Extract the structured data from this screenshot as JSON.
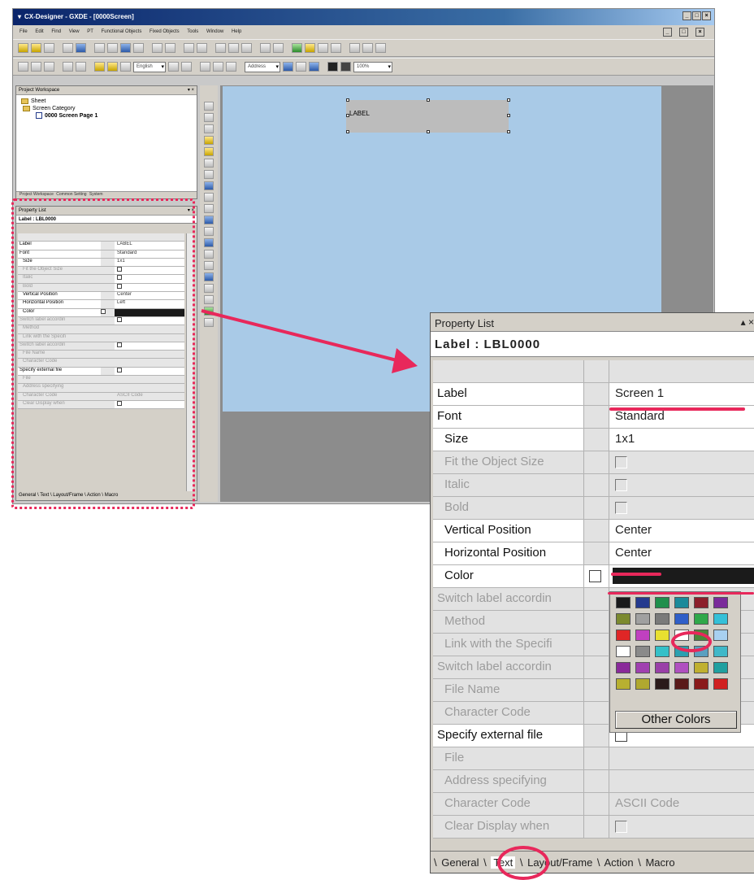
{
  "app": {
    "title": "CX-Designer - GXDE - [0000Screen]",
    "menu": [
      "File",
      "Edit",
      "Find",
      "View",
      "PT",
      "Functional Objects",
      "Fixed Objects",
      "Tools",
      "Window",
      "Help"
    ],
    "combo_language": "English",
    "combo_address": "Address",
    "combo_zoom": "100%"
  },
  "workspace": {
    "title": "Project Workspace",
    "tree": [
      "Sheet",
      "Screen Category",
      "0000 Screen Page 1"
    ],
    "tabs": [
      "Project Workspace",
      "Common Setting",
      "System"
    ]
  },
  "canvas": {
    "label_text": "LABEL"
  },
  "small_plist": {
    "title": "Property List",
    "object": "Label : LBL0000",
    "rows": [
      {
        "name": "Label",
        "value": "LABEL"
      },
      {
        "name": "Font",
        "value": "Standard"
      },
      {
        "name": "Size",
        "value": "1x1"
      },
      {
        "name": "Fit the Object Size",
        "value": ""
      },
      {
        "name": "Italic",
        "value": ""
      },
      {
        "name": "Bold",
        "value": ""
      },
      {
        "name": "Vertical Position",
        "value": "Center"
      },
      {
        "name": "Horizontal Position",
        "value": "Left"
      },
      {
        "name": "Color",
        "value": ""
      },
      {
        "name": "Switch label accordin",
        "value": ""
      },
      {
        "name": "Method",
        "value": ""
      },
      {
        "name": "Link with the Specifi",
        "value": ""
      },
      {
        "name": "Switch label accordin",
        "value": ""
      },
      {
        "name": "File Name",
        "value": ""
      },
      {
        "name": "Character Code",
        "value": ""
      },
      {
        "name": "Specify external file",
        "value": ""
      },
      {
        "name": "File",
        "value": ""
      },
      {
        "name": "Address specifying",
        "value": ""
      },
      {
        "name": "Character Code",
        "value": "ASCII Code"
      },
      {
        "name": "Clear Display when",
        "value": ""
      }
    ],
    "tabs": [
      "General",
      "Text",
      "Layout/Frame",
      "Action",
      "Macro"
    ]
  },
  "property_list": {
    "title": "Property List",
    "object": "Label : LBL0000",
    "rows": [
      {
        "name": "Label",
        "value": "Screen 1"
      },
      {
        "name": "Font",
        "value": "Standard"
      },
      {
        "name": "Size",
        "value": "1x1"
      },
      {
        "name": "Fit the Object Size",
        "value": ""
      },
      {
        "name": "Italic",
        "value": ""
      },
      {
        "name": "Bold",
        "value": ""
      },
      {
        "name": "Vertical Position",
        "value": "Center"
      },
      {
        "name": "Horizontal Position",
        "value": "Center"
      },
      {
        "name": "Color",
        "value": ""
      },
      {
        "name": "Switch label accordin",
        "value": ""
      },
      {
        "name": "Method",
        "value": ""
      },
      {
        "name": "Link with the Specifi",
        "value": ""
      },
      {
        "name": "Switch label accordin",
        "value": ""
      },
      {
        "name": "File Name",
        "value": ""
      },
      {
        "name": "Character Code",
        "value": ""
      },
      {
        "name": "Specify external file",
        "value": ""
      },
      {
        "name": "File",
        "value": ""
      },
      {
        "name": "Address specifying",
        "value": ""
      },
      {
        "name": "Character Code",
        "value": "ASCII Code"
      },
      {
        "name": "Clear Display when",
        "value": ""
      }
    ],
    "palette": [
      "#1a1a1a",
      "#253a8e",
      "#1f8f4c",
      "#1b8a9a",
      "#8c1f2b",
      "#7a2b9a",
      "#7c8a2e",
      "#a0a0a0",
      "#7a7a7a",
      "#2f5fc8",
      "#2fa84a",
      "#35c0d8",
      "#e02626",
      "#c040c0",
      "#e8e030",
      "#ffffff",
      "#4a8a3a",
      "#a8d0f0",
      "#ffffff",
      "#8a8a8a",
      "#35c0c8",
      "#2aa0b0",
      "#5aa0c0",
      "#40b8c8",
      "#8a2a9a",
      "#a040b0",
      "#9a40a8",
      "#b050c0",
      "#c0b030",
      "#20a0a0",
      "#b8b030",
      "#b0a830",
      "#2a1a1a",
      "#5a1a1a",
      "#8a1a1a",
      "#d02020"
    ],
    "other_colors": "Other Colors",
    "tabs": [
      "General",
      "Text",
      "Layout/Frame",
      "Action",
      "Macro"
    ]
  },
  "colors": {
    "annotation": "#e8285b",
    "canvas": "#a9cae7"
  }
}
